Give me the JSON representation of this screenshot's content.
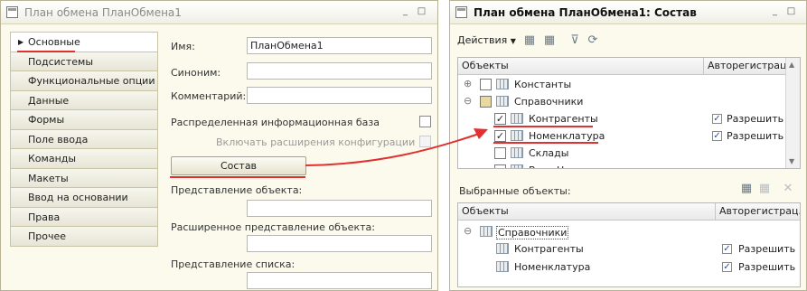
{
  "left_window": {
    "title": "План обмена ПланОбмена1",
    "buttons": [
      "_",
      "□"
    ],
    "tabs": [
      "Основные",
      "Подсистемы",
      "Функциональные опции",
      "Данные",
      "Формы",
      "Поле ввода",
      "Команды",
      "Макеты",
      "Ввод на основании",
      "Права",
      "Прочее"
    ],
    "active_tab_index": 0,
    "form": {
      "name_label": "Имя:",
      "name_value": "ПланОбмена1",
      "synonym_label": "Синоним:",
      "synonym_value": "",
      "comment_label": "Комментарий:",
      "comment_value": "",
      "distributed_label": "Распределенная информационная база",
      "config_ext_label": "Включать расширения конфигурации",
      "composition_button": "Состав",
      "object_repr_label": "Представление объекта:",
      "ext_object_repr_label": "Расширенное представление объекта:",
      "list_repr_label": "Представление списка:"
    }
  },
  "right_window": {
    "title": "План обмена ПланОбмена1: Состав",
    "buttons": [
      "_",
      "□"
    ],
    "toolbar": {
      "actions_label": "Действия"
    },
    "objects_panel": {
      "columns": [
        "Объекты",
        "Авторегистрац..."
      ],
      "rows": [
        {
          "name": "Константы",
          "checked": false,
          "expand": "⊕",
          "autoreg": ""
        },
        {
          "name": "Справочники",
          "checked": "partial",
          "expand": "⊖",
          "autoreg": ""
        },
        {
          "name": "Контрагенты",
          "checked": true,
          "expand": "",
          "autoreg": "Разрешить"
        },
        {
          "name": "Номенклатура",
          "checked": true,
          "expand": "",
          "autoreg": "Разрешить"
        },
        {
          "name": "Склады",
          "checked": false,
          "expand": "",
          "autoreg": ""
        },
        {
          "name": "ВидыНоменклатуры",
          "checked": false,
          "expand": "",
          "autoreg": ""
        }
      ]
    },
    "selected_label": "Выбранные объекты:",
    "selected_panel": {
      "columns": [
        "Объекты",
        "Авторегистрац..."
      ],
      "group": "Справочники",
      "group_expand": "⊖",
      "rows": [
        {
          "name": "Контрагенты",
          "autoreg": "Разрешить"
        },
        {
          "name": "Номенклатура",
          "autoreg": "Разрешить"
        }
      ]
    }
  },
  "colors": {
    "annotation_red": "#e03030",
    "window_bg": "#fbfaed"
  }
}
